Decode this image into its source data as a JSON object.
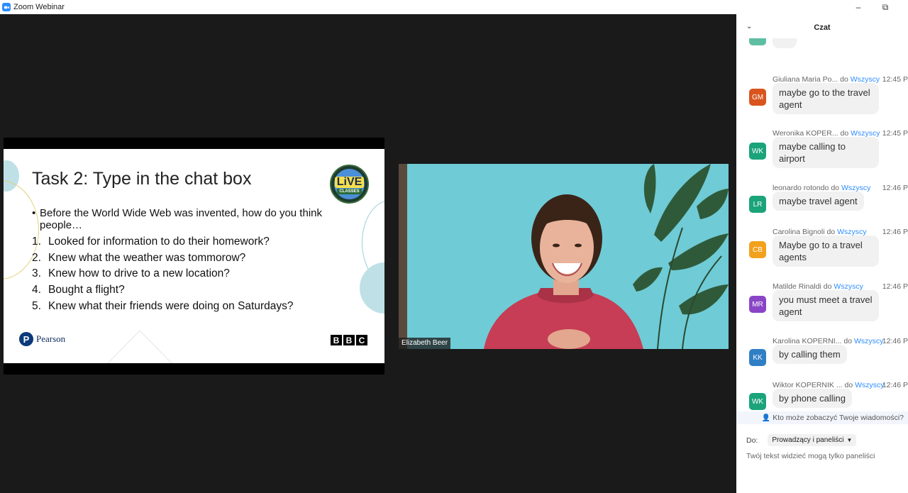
{
  "window": {
    "title": "Zoom Webinar",
    "minimize": "–",
    "restore": "⧉"
  },
  "slide": {
    "title": "Task 2: Type in the chat box",
    "intro_bullet": "•",
    "intro": "Before the World Wide Web was invented, how do you think people…",
    "items": [
      {
        "num": "1.",
        "text": "Looked for information to do their homework?"
      },
      {
        "num": "2.",
        "text": "Knew what the weather was tommorow?"
      },
      {
        "num": "3.",
        "text": "Knew how to drive to a new location?"
      },
      {
        "num": "4.",
        "text": "Bought a flight?"
      },
      {
        "num": "5.",
        "text": "Knew what their friends were doing on Saturdays?"
      }
    ],
    "badge_top": "LiVE",
    "badge_bottom": "CLASSES",
    "pearson_mark": "P",
    "pearson_name": "Pearson",
    "bbc": [
      "B",
      "B",
      "C"
    ]
  },
  "video": {
    "participant_name": "Elizabeth Beer"
  },
  "chat": {
    "title": "Czat",
    "collapse_icon": "⌄",
    "to_word": "do",
    "messages": [
      {
        "sender": "Giuliana Maria Po...",
        "recipient": "Wszyscy",
        "time": "12:45 P",
        "initials": "GM",
        "color": "#d9541e",
        "text": "maybe go to the travel agent"
      },
      {
        "sender": "Weronika KOPER...",
        "recipient": "Wszyscy",
        "time": "12:45 P",
        "initials": "WK",
        "color": "#1ba37a",
        "text": "maybe calling to airport"
      },
      {
        "sender": "leonardo rotondo",
        "recipient": "Wszyscy",
        "time": "12:46 P",
        "initials": "LR",
        "color": "#1ba37a",
        "text": "maybe  travel agent"
      },
      {
        "sender": "Carolina Bignoli",
        "recipient": "Wszyscy",
        "time": "12:46 P",
        "initials": "CB",
        "color": "#f2a11d",
        "text": "Maybe go to a travel agents"
      },
      {
        "sender": "Matilde Rinaldi",
        "recipient": "Wszyscy",
        "time": "12:46 P",
        "initials": "MR",
        "color": "#8a45c6",
        "text": "you must meet a travel agent"
      },
      {
        "sender": "Karolina KOPERNI...",
        "recipient": "Wszyscy",
        "time": "12:46 P",
        "initials": "KK",
        "color": "#2f7fc4",
        "text": "by calling them"
      },
      {
        "sender": "Wiktor KOPERNIK ...",
        "recipient": "Wszyscy",
        "time": "12:46 P",
        "initials": "WK",
        "color": "#1ba37a",
        "text": "by phone calling"
      }
    ],
    "visibility_note": "Kto może zobaczyć Twoje wiadomości?",
    "to_label": "Do:",
    "to_value": "Prowadzący i paneliści",
    "input_hint": "Twój tekst widzieć mogą tylko paneliści"
  },
  "colors": {
    "accent": "#2d8cff",
    "stage": "#1a1a1a"
  }
}
